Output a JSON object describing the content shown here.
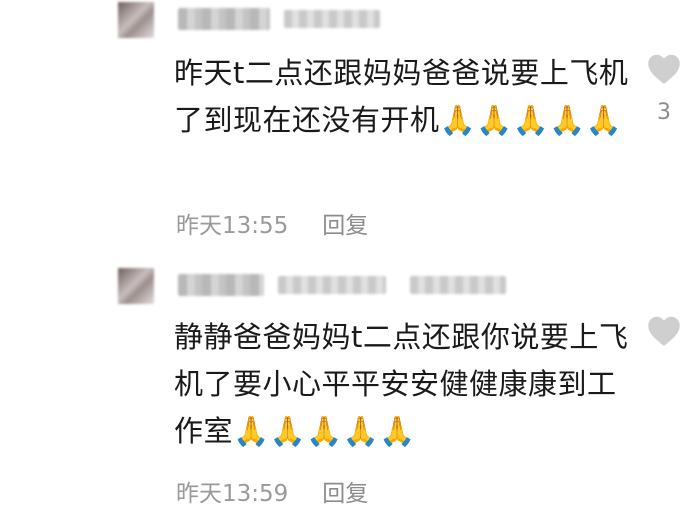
{
  "comments": [
    {
      "username": "",
      "text": "昨天t二点还跟妈妈爸爸说要上飞机了到现在还没有开机🙏🙏🙏🙏🙏",
      "time": "昨天13:55",
      "reply_label": "回复",
      "like_count": "3",
      "like_icon": "heart-outline-icon"
    },
    {
      "username": "",
      "text": "静静爸爸妈妈t二点还跟你说要上飞机了要小心平平安安健健康康到工作室🙏🙏🙏🙏🙏",
      "time": "昨天13:59",
      "reply_label": "回复",
      "like_count": "",
      "like_icon": "heart-outline-icon"
    }
  ],
  "colors": {
    "text": "#1a1a1a",
    "meta": "#9a9a9a",
    "heart": "#cfcfcf",
    "background": "#ffffff"
  }
}
